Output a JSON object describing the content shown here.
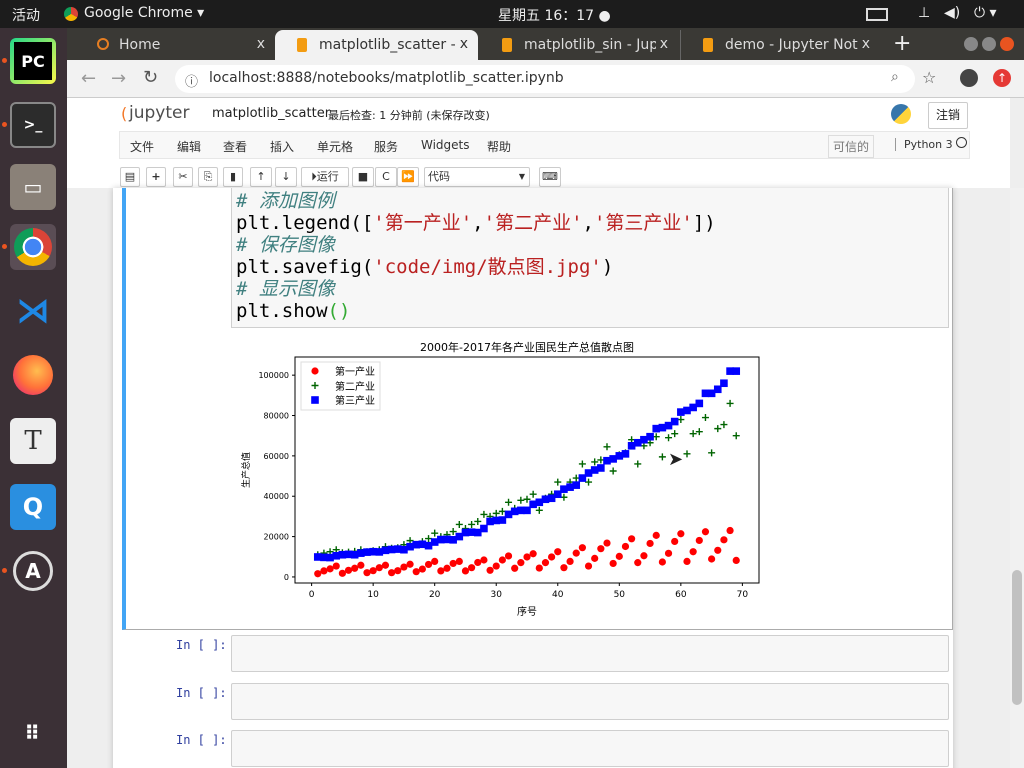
{
  "topbar": {
    "activities": "活动",
    "app": "Google Chrome ▾",
    "clock": "星期五 16：17 ●",
    "icons": [
      "keyboard-icon",
      "network-icon",
      "volume-icon",
      "power-icon"
    ]
  },
  "dock": [
    "pycharm",
    "terminal",
    "files",
    "chrome",
    "vscode",
    "firefox",
    "text-editor",
    "qq-app",
    "software-updater",
    "show-apps"
  ],
  "tabs": [
    {
      "label": "Home",
      "active": false
    },
    {
      "label": "matplotlib_scatter -",
      "active": true
    },
    {
      "label": "matplotlib_sin - Jup",
      "active": false
    },
    {
      "label": "demo - Jupyter Not",
      "active": false
    }
  ],
  "address": {
    "url": "localhost:8888/notebooks/matplotlib_scatter.ipynb"
  },
  "jupyter": {
    "logo": "jupyter",
    "notebook_name": "matplotlib_scatter",
    "checkpoint": "最后检查: 1 分钟前  (未保存改变)",
    "logout": "注销",
    "menu": [
      "文件",
      "编辑",
      "查看",
      "插入",
      "单元格",
      "服务",
      "Widgets",
      "帮助"
    ],
    "trusted": "可信的",
    "kernel": "Python 3",
    "toolbar": {
      "run": "运行",
      "cell_type": "代码"
    }
  },
  "code_lines": [
    [
      {
        "t": "# 添加图例",
        "k": "comment"
      }
    ],
    [
      {
        "t": "plt.legend([",
        "k": "plain"
      },
      {
        "t": "'第一产业'",
        "k": "str"
      },
      {
        "t": ",",
        "k": "plain"
      },
      {
        "t": "'第二产业'",
        "k": "str"
      },
      {
        "t": ",",
        "k": "plain"
      },
      {
        "t": "'第三产业'",
        "k": "str"
      },
      {
        "t": "])",
        "k": "plain"
      }
    ],
    [
      {
        "t": "# 保存图像",
        "k": "comment"
      }
    ],
    [
      {
        "t": "plt.savefig(",
        "k": "plain"
      },
      {
        "t": "'code/img/散点图.jpg'",
        "k": "str"
      },
      {
        "t": ")",
        "k": "plain"
      }
    ],
    [
      {
        "t": "# 显示图像",
        "k": "comment"
      }
    ],
    [
      {
        "t": "plt.show",
        "k": "plain"
      },
      {
        "t": "()",
        "k": "paren"
      }
    ]
  ],
  "empty_cells": [
    {
      "prompt": "In [ ]:"
    },
    {
      "prompt": "In [ ]:"
    },
    {
      "prompt": "In [ ]:"
    }
  ],
  "chart_data": {
    "type": "scatter",
    "title": "2000年-2017年各产业国民生产总值散点图",
    "xlabel": "序号",
    "ylabel": "生产总值",
    "xlim": [
      -2.7,
      72.7
    ],
    "ylim": [
      -3000,
      109000
    ],
    "xticks": [
      0,
      10,
      20,
      30,
      40,
      50,
      60,
      70
    ],
    "yticks": [
      0,
      20000,
      40000,
      60000,
      80000,
      100000
    ],
    "legend_position": "top-left",
    "grid": false,
    "series": [
      {
        "name": "第一产业",
        "marker": "circle",
        "color": "#ff0000",
        "values": [
          1600,
          3000,
          4000,
          5400,
          1800,
          3300,
          4300,
          5800,
          2100,
          3100,
          4600,
          5800,
          2100,
          3100,
          4900,
          6300,
          2600,
          3900,
          6200,
          7700,
          3000,
          4300,
          6700,
          7700,
          3000,
          4600,
          7200,
          8400,
          3300,
          5400,
          8400,
          10400,
          4300,
          7100,
          9900,
          11500,
          4400,
          7100,
          9900,
          12500,
          4600,
          7700,
          11800,
          14500,
          5400,
          9200,
          14000,
          16800,
          6700,
          10200,
          15100,
          18900,
          7100,
          10500,
          16600,
          20600,
          7400,
          11700,
          17600,
          21400,
          7700,
          12500,
          18100,
          22400,
          8900,
          13200,
          18400,
          23000,
          8200
        ]
      },
      {
        "name": "第二产业",
        "marker": "plus",
        "color": "#006400",
        "values": [
          11000,
          11800,
          12500,
          13500,
          12000,
          12300,
          12700,
          13500,
          12500,
          13000,
          13500,
          15000,
          14200,
          14500,
          16000,
          18000,
          16000,
          17500,
          19000,
          21700,
          20000,
          21000,
          22500,
          26000,
          24000,
          26000,
          27500,
          31000,
          30000,
          31500,
          32500,
          37000,
          34000,
          38000,
          38500,
          41000,
          33000,
          39000,
          41000,
          47000,
          39500,
          47000,
          49000,
          56000,
          47000,
          57000,
          58000,
          64500,
          52500,
          60500,
          61500,
          68000,
          56000,
          65000,
          66500,
          69500,
          59500,
          69000,
          71000,
          78000,
          61000,
          71000,
          72000,
          79000,
          61500,
          73500,
          75500,
          86000,
          70000
        ]
      },
      {
        "name": "第三产业",
        "marker": "square",
        "color": "#0000ff",
        "values": [
          9900,
          9700,
          9600,
          10500,
          11000,
          11200,
          11000,
          11800,
          12300,
          12500,
          12400,
          13200,
          13600,
          13800,
          13500,
          15000,
          16000,
          16200,
          15500,
          17300,
          18500,
          18600,
          18400,
          20000,
          22000,
          22200,
          22000,
          24000,
          27500,
          28000,
          28200,
          31000,
          32500,
          33000,
          33000,
          36000,
          37000,
          38500,
          39000,
          41000,
          43500,
          44500,
          45500,
          49000,
          51500,
          53000,
          54000,
          57600,
          58500,
          60000,
          61000,
          65000,
          66500,
          68000,
          69500,
          73500,
          74000,
          75000,
          77000,
          81700,
          82500,
          84000,
          86000,
          91000,
          91000,
          93000,
          96000,
          102000,
          102000
        ]
      }
    ]
  }
}
